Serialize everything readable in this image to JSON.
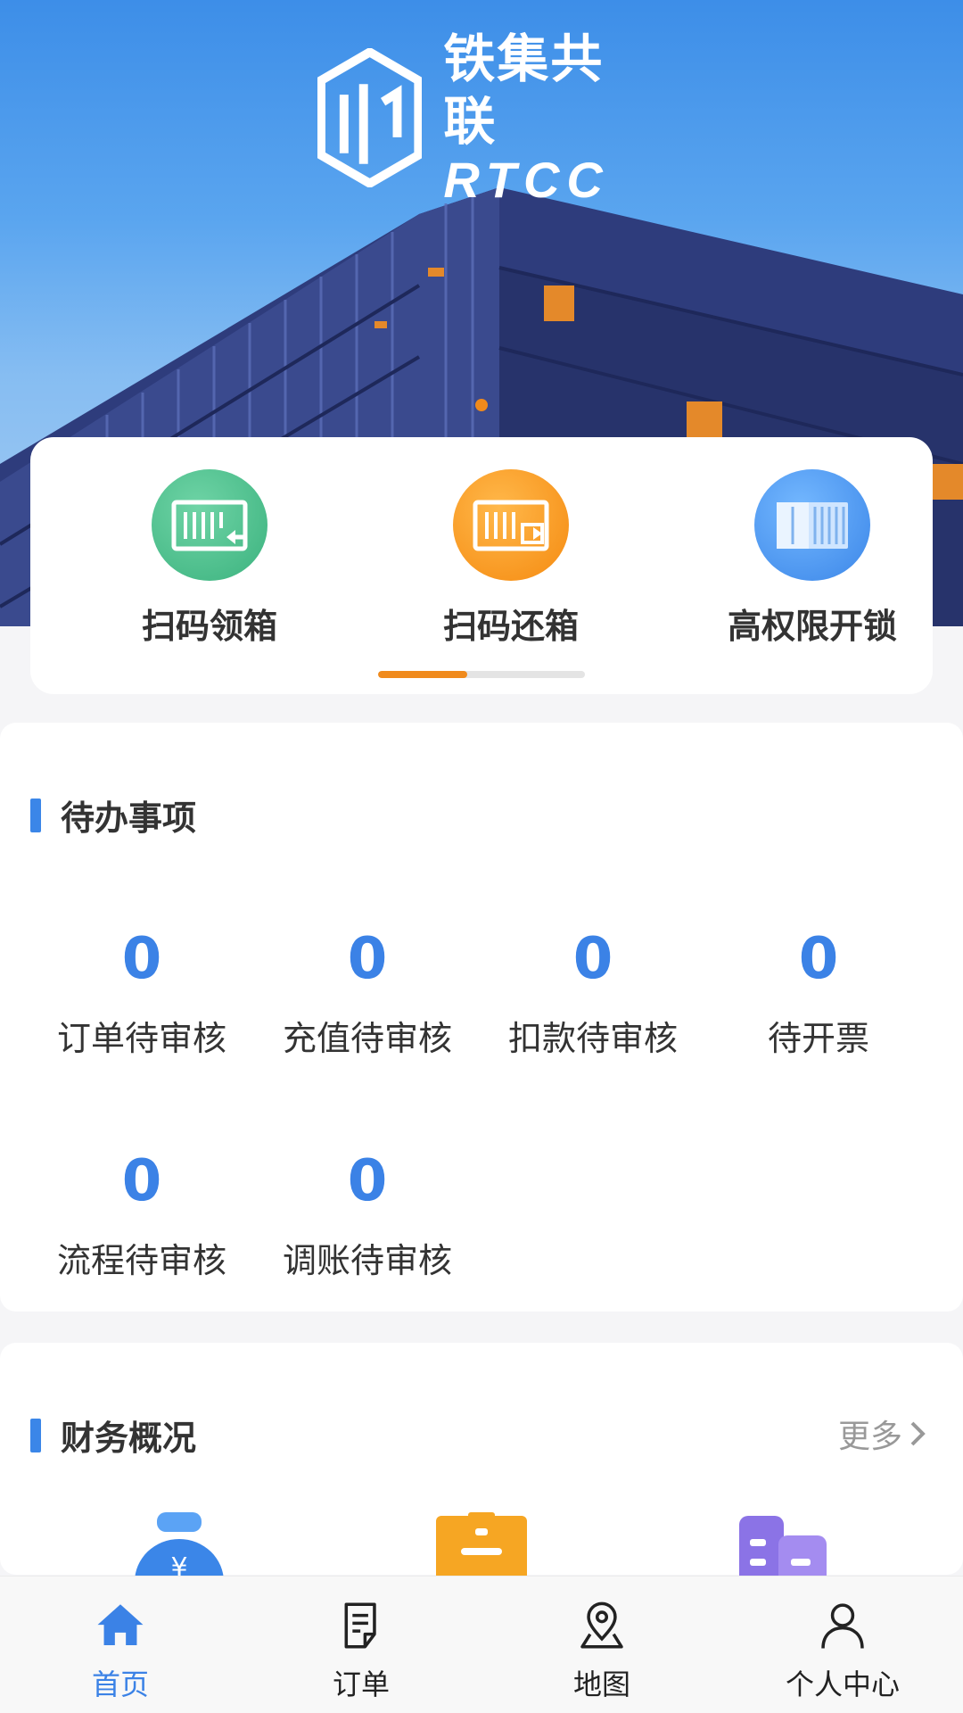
{
  "banner": {
    "logo_cn": "铁集共联",
    "logo_en": "RTCC",
    "indicator_color": "#f08a1c"
  },
  "quick_actions": {
    "items": [
      {
        "label": "扫码领箱",
        "icon": "container-scan-in-icon",
        "color": "#3bb27e"
      },
      {
        "label": "扫码还箱",
        "icon": "container-scan-out-icon",
        "color": "#f58a10"
      },
      {
        "label": "高权限开锁",
        "icon": "container-unlock-icon",
        "color": "#3b86e8"
      }
    ],
    "scroll_progress": 0.43
  },
  "todo": {
    "title": "待办事项",
    "items": [
      {
        "value": "0",
        "label": "订单待审核"
      },
      {
        "value": "0",
        "label": "充值待审核"
      },
      {
        "value": "0",
        "label": "扣款待审核"
      },
      {
        "value": "0",
        "label": "待开票"
      },
      {
        "value": "0",
        "label": "流程待审核"
      },
      {
        "value": "0",
        "label": "调账待审核"
      }
    ]
  },
  "finance": {
    "title": "财务概况",
    "more_label": "更多",
    "icons": [
      "money-bag-icon",
      "clipboard-icon",
      "building-icon"
    ]
  },
  "tabbar": {
    "active": 0,
    "accent": "#3b82e6",
    "items": [
      {
        "label": "首页",
        "icon": "home-icon"
      },
      {
        "label": "订单",
        "icon": "order-document-icon"
      },
      {
        "label": "地图",
        "icon": "map-pin-icon"
      },
      {
        "label": "个人中心",
        "icon": "user-profile-icon"
      }
    ]
  }
}
